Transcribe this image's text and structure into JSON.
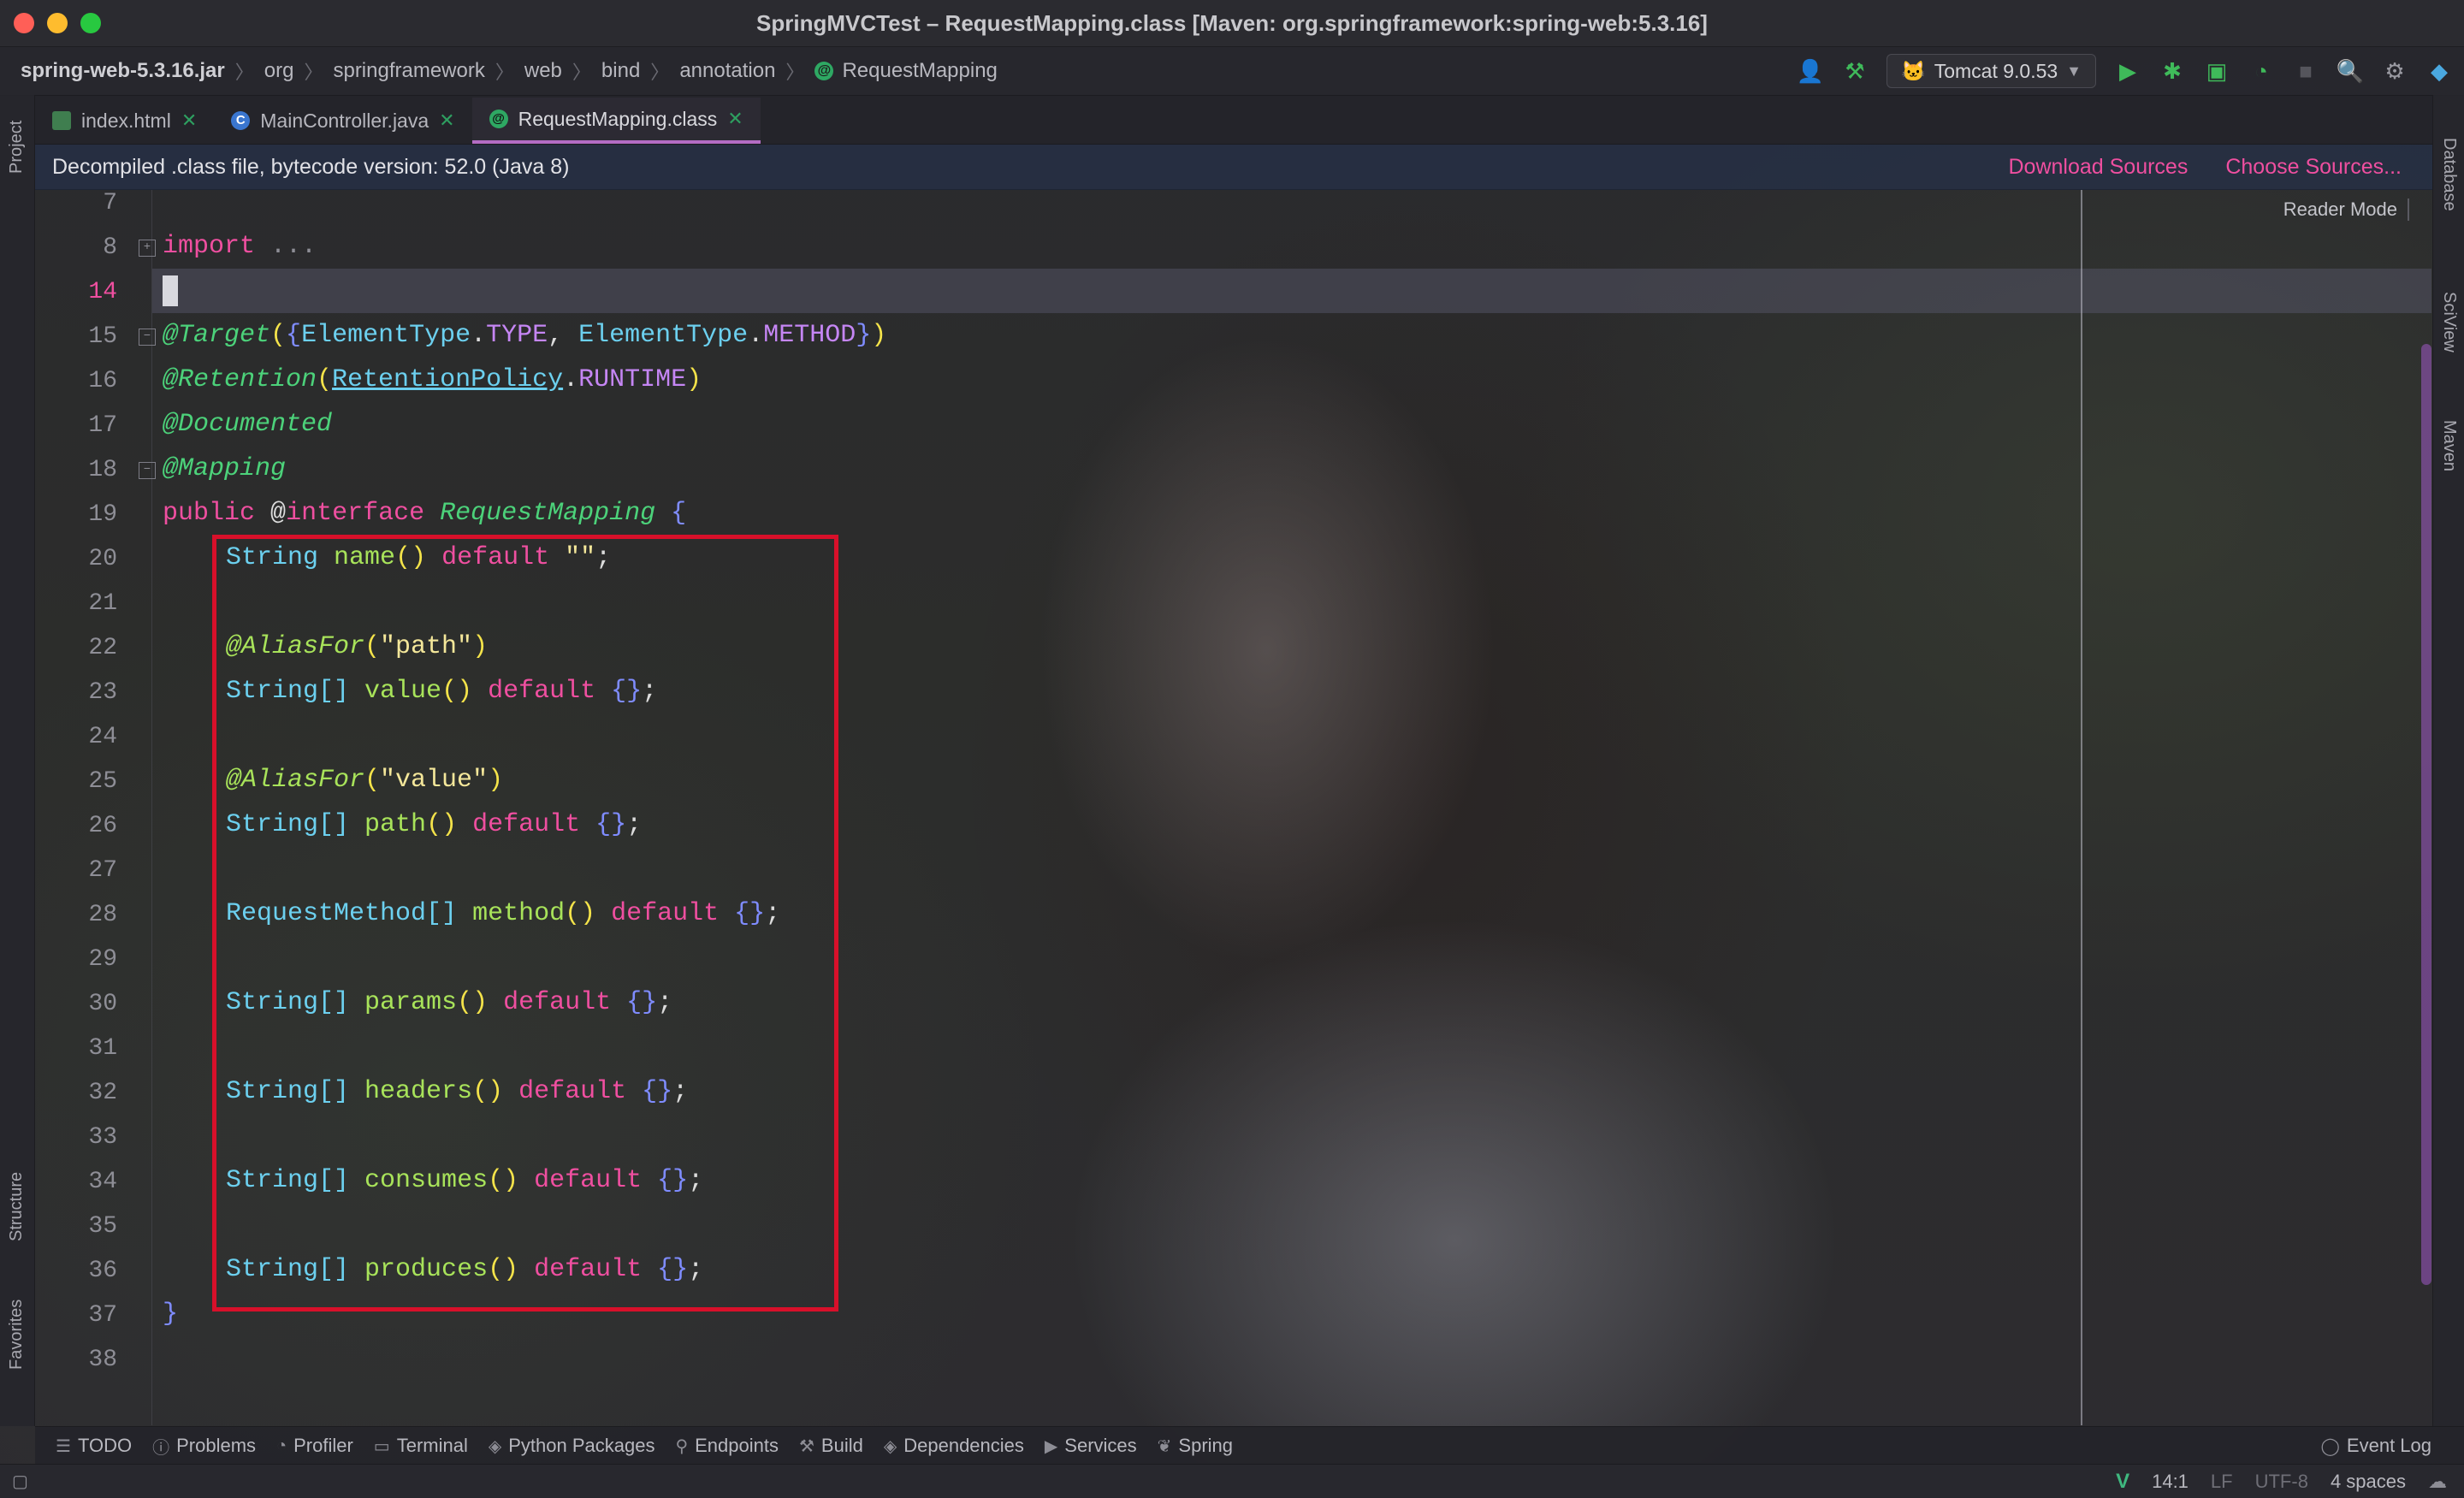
{
  "window": {
    "title": "SpringMVCTest – RequestMapping.class [Maven: org.springframework:spring-web:5.3.16]"
  },
  "breadcrumb": {
    "jar": "spring-web-5.3.16.jar",
    "parts": [
      "org",
      "springframework",
      "web",
      "bind",
      "annotation"
    ],
    "current": "RequestMapping"
  },
  "toolbar": {
    "run_config": "Tomcat 9.0.53"
  },
  "left_tools": [
    "Project",
    "Structure",
    "Favorites"
  ],
  "right_tools": [
    "Database",
    "SciView",
    "Maven"
  ],
  "tabs": [
    {
      "label": "index.html",
      "active": false
    },
    {
      "label": "MainController.java",
      "active": false
    },
    {
      "label": "RequestMapping.class",
      "active": true
    }
  ],
  "banner": {
    "message": "Decompiled .class file, bytecode version: 52.0 (Java 8)",
    "download_sources": "Download Sources",
    "choose_sources": "Choose Sources..."
  },
  "editor": {
    "reader_mode": "Reader Mode",
    "line_numbers": [
      "7",
      "8",
      "14",
      "15",
      "16",
      "17",
      "18",
      "19",
      "20",
      "21",
      "22",
      "23",
      "24",
      "25",
      "26",
      "27",
      "28",
      "29",
      "30",
      "31",
      "32",
      "33",
      "34",
      "35",
      "36",
      "37",
      "38"
    ],
    "current_line": "14",
    "code": {
      "import_kw": "import",
      "import_rest": " ...",
      "target_ann": "@Target",
      "elementtype1": "ElementType",
      "type_const": "TYPE",
      "elementtype2": "ElementType",
      "method_const": "METHOD",
      "retention_ann": "@Retention",
      "retention_policy": "RetentionPolicy",
      "runtime_const": "RUNTIME",
      "documented_ann": "@Documented",
      "mapping_ann": "@Mapping",
      "public_kw": "public",
      "at_sign": "@",
      "interface_kw": "interface",
      "class_name": "RequestMapping",
      "open_brace": "{",
      "string_type": "String",
      "name_method": "name",
      "default_kw": "default",
      "empty_string": "\"\"",
      "aliasfor_ann": "@AliasFor",
      "path_str": "\"path\"",
      "string_array": "String[]",
      "value_method": "value",
      "value_str": "\"value\"",
      "path_method": "path",
      "requestmethod_array": "RequestMethod[]",
      "method_method": "method",
      "params_method": "params",
      "headers_method": "headers",
      "consumes_method": "consumes",
      "produces_method": "produces",
      "close_brace": "}"
    }
  },
  "tool_windows": [
    "TODO",
    "Problems",
    "Profiler",
    "Terminal",
    "Python Packages",
    "Endpoints",
    "Build",
    "Dependencies",
    "Services",
    "Spring"
  ],
  "event_log": "Event Log",
  "status": {
    "position": "14:1",
    "line_sep": "LF",
    "encoding": "UTF-8",
    "indent": "4 spaces"
  }
}
